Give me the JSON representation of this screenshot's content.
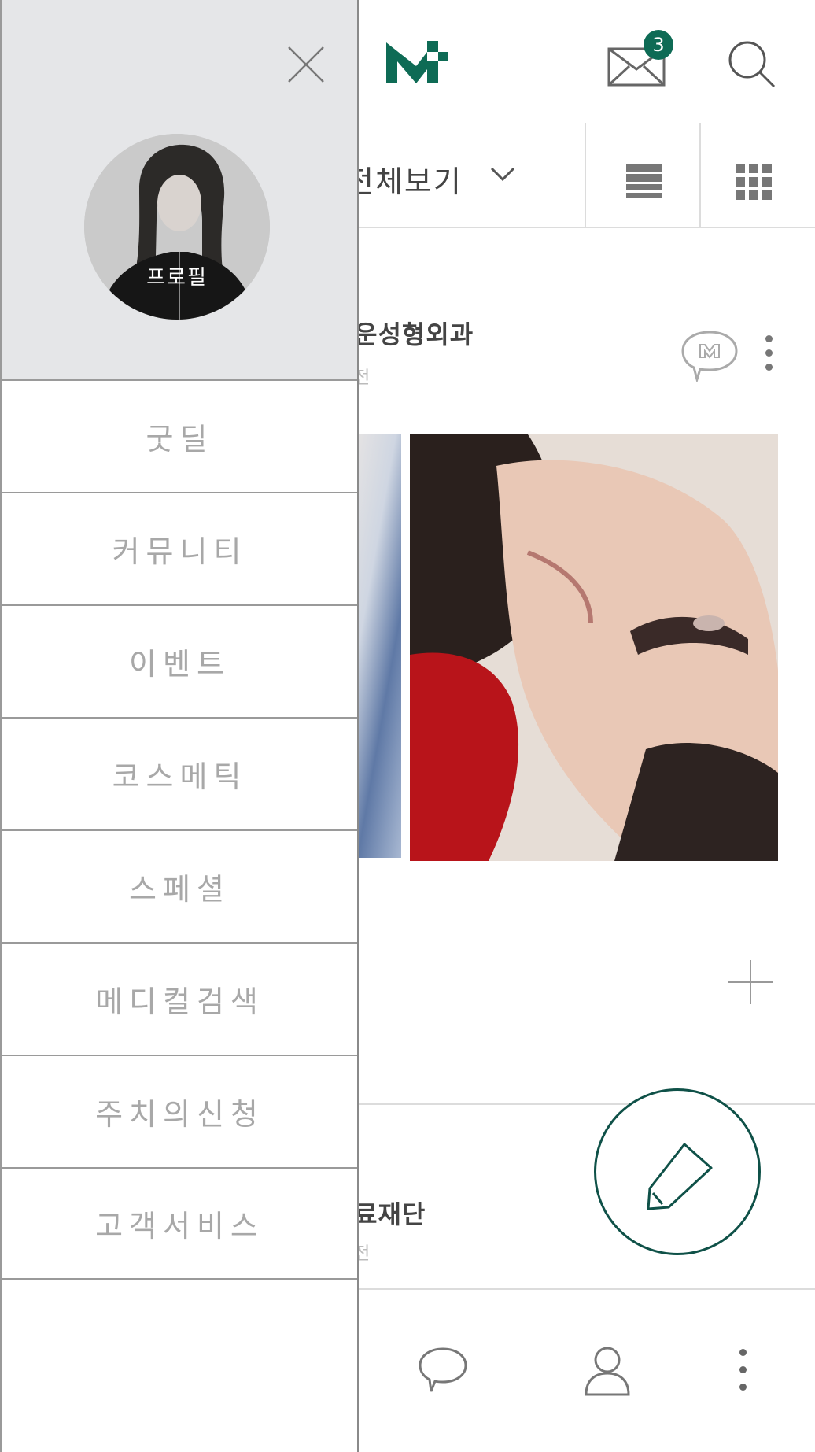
{
  "app": {
    "brand_color": "#0e6b55",
    "accent_dark": "#0f5148"
  },
  "header": {
    "logo_icon": "m-logo-icon",
    "message_badge_count": "3",
    "message_icon": "envelope-icon",
    "search_icon": "search-icon"
  },
  "filter": {
    "label": "전체보기",
    "dropdown_icon": "chevron-down-icon",
    "list_view_icon": "list-view-icon",
    "grid_view_icon": "grid-view-icon"
  },
  "feed": {
    "posts": [
      {
        "author": "운성형외과",
        "time": "전"
      },
      {
        "author": "료재단",
        "time": "전"
      }
    ]
  },
  "drawer": {
    "profile_label": "프로필",
    "menu": [
      {
        "label": "굿딜"
      },
      {
        "label": "커뮤니티"
      },
      {
        "label": "이벤트"
      },
      {
        "label": "코스메틱"
      },
      {
        "label": "스페셜"
      },
      {
        "label": "메디컬검색"
      },
      {
        "label": "주치의신청"
      },
      {
        "label": "고객서비스"
      }
    ]
  }
}
